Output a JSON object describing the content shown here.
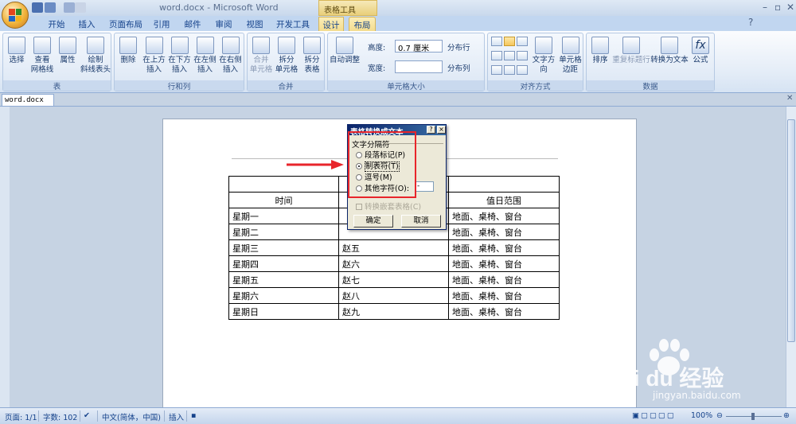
{
  "window": {
    "title": "word.docx - Microsoft Word",
    "context_group": "表格工具"
  },
  "tabs": [
    "开始",
    "插入",
    "页面布局",
    "引用",
    "邮件",
    "审阅",
    "视图",
    "开发工具",
    "设计",
    "布局"
  ],
  "ribbon": {
    "groups": [
      "表",
      "行和列",
      "合并",
      "单元格大小",
      "对齐方式",
      "数据"
    ],
    "table_group": [
      {
        "l1": "选择",
        "l2": ""
      },
      {
        "l1": "查看",
        "l2": "网格线"
      },
      {
        "l1": "属性",
        "l2": ""
      },
      {
        "l1": "绘制",
        "l2": "斜线表头"
      }
    ],
    "rows_cols": [
      {
        "l1": "删除",
        "l2": ""
      },
      {
        "l1": "在上方",
        "l2": "插入"
      },
      {
        "l1": "在下方",
        "l2": "插入"
      },
      {
        "l1": "在左侧",
        "l2": "插入"
      },
      {
        "l1": "在右侧",
        "l2": "插入"
      }
    ],
    "merge": [
      {
        "l1": "合并",
        "l2": "单元格"
      },
      {
        "l1": "拆分",
        "l2": "单元格"
      },
      {
        "l1": "拆分",
        "l2": "表格"
      }
    ],
    "cell_size": {
      "auto_fit": "自动调整",
      "height_label": "高度:",
      "height_value": "0.7 厘米",
      "width_label": "宽度:",
      "width_value": "",
      "distribute_rows": "分布行",
      "distribute_cols": "分布列"
    },
    "align": {
      "text_direction": "文字方向",
      "margins_l1": "单元格",
      "margins_l2": "边距"
    },
    "data": [
      {
        "l1": "排序",
        "l2": ""
      },
      {
        "l1": "重复标题行",
        "l2": ""
      },
      {
        "l1": "转换为文本",
        "l2": ""
      },
      {
        "l1": "公式",
        "l2": ""
      }
    ]
  },
  "doc_tab": "word.docx",
  "table": {
    "headers": [
      "时间",
      "",
      "值日范围"
    ],
    "rows": [
      [
        "星期一",
        "",
        "地面、桌椅、窗台"
      ],
      [
        "星期二",
        "",
        "地面、桌椅、窗台"
      ],
      [
        "星期三",
        "赵五",
        "地面、桌椅、窗台"
      ],
      [
        "星期四",
        "赵六",
        "地面、桌椅、窗台"
      ],
      [
        "星期五",
        "赵七",
        "地面、桌椅、窗台"
      ],
      [
        "星期六",
        "赵八",
        "地面、桌椅、窗台"
      ],
      [
        "星期日",
        "赵九",
        "地面、桌椅、窗台"
      ]
    ]
  },
  "dialog": {
    "title": "表格转换成文本",
    "help": "?",
    "close": "×",
    "group_label": "文字分隔符",
    "options": [
      "段落标记(P)",
      "制表符(T)",
      "逗号(M)",
      "其他字符(O):"
    ],
    "selected_option": 1,
    "other_char_value": "-",
    "nested_label": "转换嵌套表格(C)",
    "ok": "确定",
    "cancel": "取消"
  },
  "status": {
    "page": "页面: 1/1",
    "words": "字数: 102",
    "lang": "中文(简体，中国)",
    "mode": "插入",
    "zoom": "100%"
  },
  "watermark": {
    "brand": "Bai du 经验",
    "url": "jingyan.baidu.com"
  },
  "colors": {
    "highlight": "#e8252b",
    "ribbon_text": "#15428b",
    "context_tab": "#f3dc8e"
  }
}
